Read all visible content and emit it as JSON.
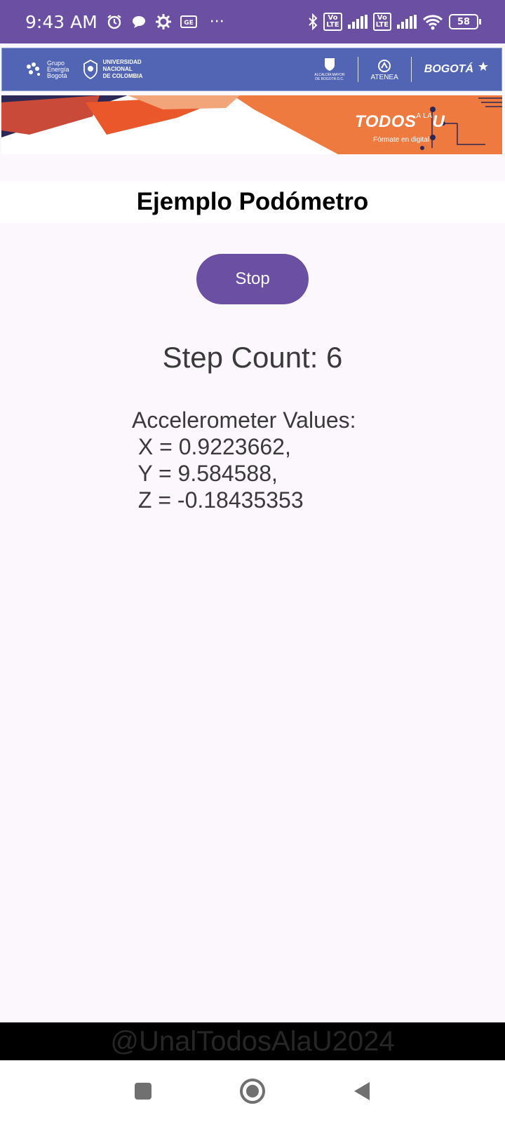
{
  "status_bar": {
    "time": "9:43 AM",
    "battery": "58",
    "overflow": "···",
    "volte_label": "Vo\nLTE",
    "icons": [
      "alarm-icon",
      "chat-icon",
      "settings-icon",
      "ge-icon",
      "bluetooth-icon",
      "volte-icon",
      "signal-icon",
      "wifi-icon",
      "battery-icon"
    ]
  },
  "banner": {
    "grupo": "Grupo\nEnergía\nBogotá",
    "universidad": "UNIVERSIDAD\nNACIONAL\nDE COLOMBIA",
    "alcaldia": "ALCALDÍA MAYOR\nDE BOGOTÁ D.C.",
    "atenea": "ATENEA",
    "bogota": "BOGOTÁ",
    "todos": "TODOS",
    "todos_small": "A LA",
    "todos_u": "U",
    "formate": "Fórmate en digital"
  },
  "app": {
    "title": "Ejemplo Podómetro",
    "stop_label": "Stop",
    "step_count": "Step Count: 6",
    "accelerometer": "Accelerometer Values:\n X = 0.9223662,\n Y = 9.584588,\n Z = -0.18435353"
  },
  "watermark": "@UnalTodosAlaU2024",
  "colors": {
    "primary": "#6a4fa3",
    "background": "#fcf6fd",
    "banner_blue": "#5264b4",
    "banner_orange": "#ee7a40"
  }
}
